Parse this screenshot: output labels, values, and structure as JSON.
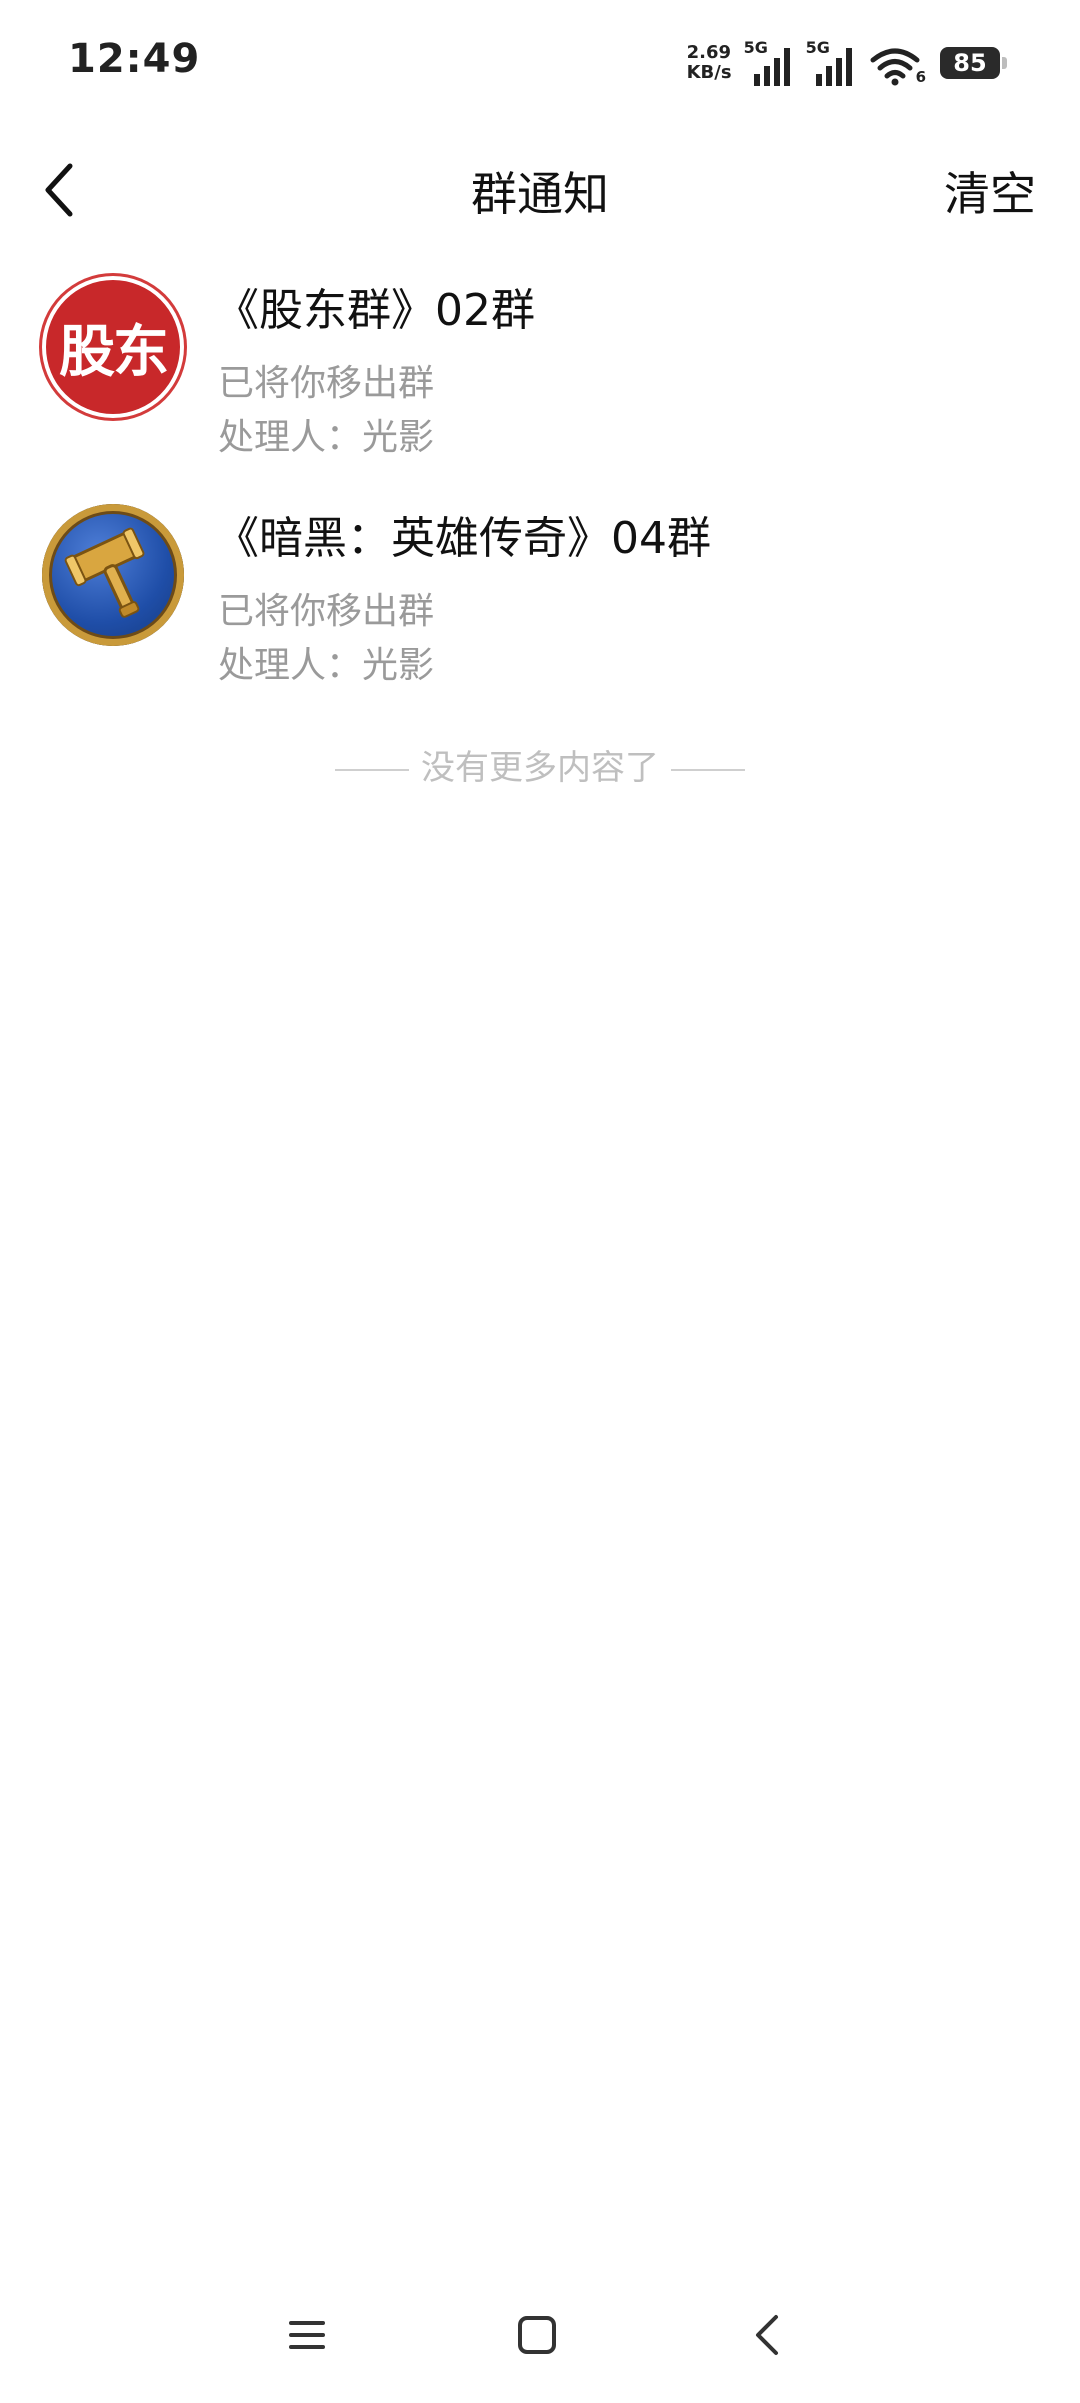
{
  "status_bar": {
    "time": "12:49",
    "net_speed_value": "2.69",
    "net_speed_unit": "KB/s",
    "sim1_tag": "5G",
    "sim2_tag": "5G",
    "wifi_tag": "6",
    "battery_level": "85",
    "icons": [
      "signal-icon",
      "signal-icon",
      "wifi-icon",
      "battery-icon"
    ]
  },
  "header": {
    "title": "群通知",
    "clear_label": "清空",
    "back_icon": "chevron-left-icon"
  },
  "notices": [
    {
      "avatar_text": "股东",
      "avatar_color": "#c8282a",
      "title": "《股东群》02群",
      "message": "已将你移出群",
      "handler_label": "处理人：",
      "handler_name": "光影"
    },
    {
      "avatar_icon": "gavel-icon",
      "avatar_color": "#1f4ea8",
      "title": "《暗黑：英雄传奇》04群",
      "message": "已将你移出群",
      "handler_label": "处理人：",
      "handler_name": "光影"
    }
  ],
  "end_text": "没有更多内容了",
  "nav_bar": {
    "icons": [
      "menu-icon",
      "home-icon",
      "back-icon"
    ]
  }
}
